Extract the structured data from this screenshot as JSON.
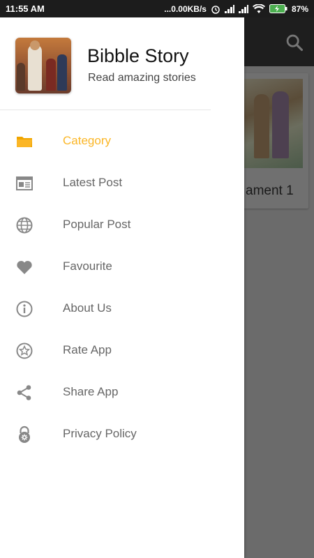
{
  "status_bar": {
    "time": "11:55 AM",
    "network_speed": "...0.00KB/s",
    "battery": "87%"
  },
  "drawer": {
    "app_name": "Bibble Story",
    "tagline": "Read amazing stories",
    "items": [
      {
        "label": "Category",
        "icon": "folder-icon",
        "active": true
      },
      {
        "label": "Latest Post",
        "icon": "newspaper-icon",
        "active": false
      },
      {
        "label": "Popular Post",
        "icon": "globe-icon",
        "active": false
      },
      {
        "label": "Favourite",
        "icon": "heart-icon",
        "active": false
      },
      {
        "label": "About Us",
        "icon": "info-icon",
        "active": false
      },
      {
        "label": "Rate App",
        "icon": "star-icon",
        "active": false
      },
      {
        "label": "Share App",
        "icon": "share-icon",
        "active": false
      },
      {
        "label": "Privacy Policy",
        "icon": "lock-icon",
        "active": false
      }
    ]
  },
  "background": {
    "card_title": "ament 1"
  },
  "colors": {
    "accent": "#fbb626",
    "icon_gray": "#888888",
    "text_gray": "#666666"
  }
}
